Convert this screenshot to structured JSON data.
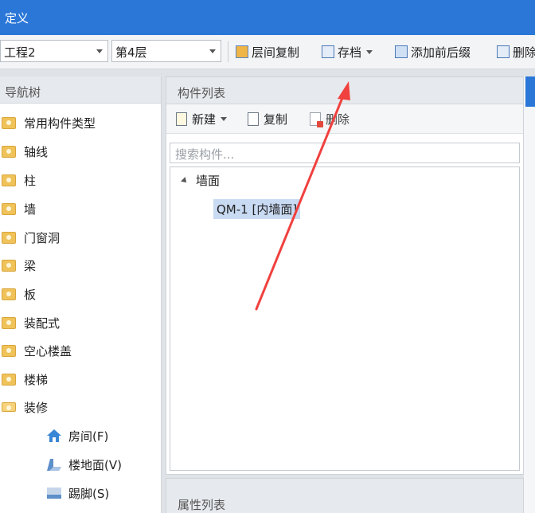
{
  "window": {
    "title": "定义"
  },
  "toolbar": {
    "project": "工程2",
    "floor": "第4层",
    "copy_floor": "层间复制",
    "archive": "存档",
    "add_prefix_suffix": "添加前后缀",
    "delete_partial": "删除"
  },
  "nav": {
    "title": "导航树",
    "items": [
      "常用构件类型",
      "轴线",
      "柱",
      "墙",
      "门窗洞",
      "梁",
      "板",
      "装配式",
      "空心楼盖",
      "楼梯",
      "装修"
    ],
    "sub_items": [
      "房间(F)",
      "楼地面(V)",
      "踢脚(S)"
    ]
  },
  "components": {
    "title": "构件列表",
    "new_label": "新建",
    "copy_label": "复制",
    "delete_label": "删除",
    "search_placeholder": "搜索构件...",
    "tree": {
      "group": "墙面",
      "selected": "QM-1 [内墙面]"
    }
  },
  "properties": {
    "title": "属性列表"
  },
  "colors": {
    "title_bar": "#2a77d8",
    "selection": "#c9daf3",
    "annotation_arrow": "#f0413e"
  }
}
